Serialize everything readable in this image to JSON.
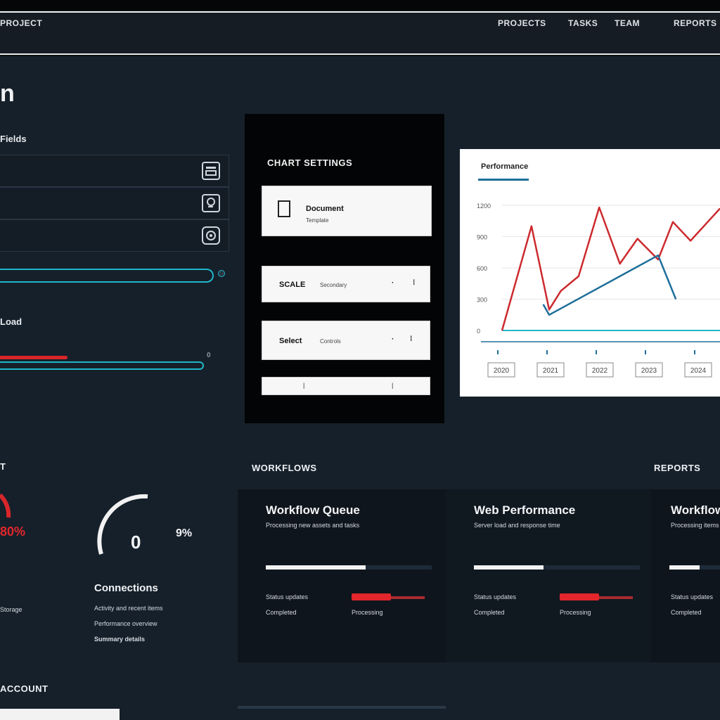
{
  "header": {
    "brand": "PROJECT",
    "nav": [
      "PROJECTS",
      "TASKS",
      "TEAM",
      "REPORTS"
    ]
  },
  "page": {
    "title": "n"
  },
  "form": {
    "section_label": "Fields",
    "inputs": [
      {
        "value": "",
        "placeholder": "",
        "icon": "save-icon"
      },
      {
        "value": "",
        "placeholder": "",
        "icon": "search-icon"
      },
      {
        "value": "",
        "placeholder": "",
        "icon": "settings-icon"
      }
    ],
    "slider_label": "Load",
    "slider_value_label": "0"
  },
  "center": {
    "title": "CHART SETTINGS",
    "cards": [
      {
        "title": "Document",
        "sub": "Template"
      },
      {
        "title": "SCALE",
        "sub": "Secondary"
      },
      {
        "title": "Select",
        "sub": "Controls"
      }
    ]
  },
  "chart_data": {
    "type": "line",
    "title": "Performance",
    "y_ticks": [
      "1200",
      "900",
      "600",
      "300",
      "0"
    ],
    "x_tick_labels": [
      "2020",
      "2021",
      "2022",
      "2023",
      "2024"
    ],
    "ylim": [
      0,
      1200
    ],
    "series": [
      {
        "color": "#cc2a2e",
        "x": [
          0,
          1,
          1.6,
          2,
          2.6,
          3.3,
          4,
          4.6,
          5.3,
          5.8,
          6.4,
          7.4
        ],
        "values": [
          0,
          1000,
          200,
          380,
          520,
          1180,
          640,
          880,
          680,
          1040,
          860,
          1170
        ]
      },
      {
        "color": "#1e6f9a",
        "x": [
          1.4,
          1.6,
          5.3,
          5.9
        ],
        "values": [
          250,
          150,
          720,
          300
        ]
      }
    ],
    "baseline_color": "#1fb7c9",
    "grid": true
  },
  "sections": {
    "left_head": "T",
    "middle_head": "WORKFLOWS",
    "right_head": "REPORTS",
    "bottom_head": "ACCOUNT"
  },
  "gauges": {
    "left_pct": "80%",
    "center_value": "0",
    "center_pct": "9%",
    "caption": "Connections",
    "lines": [
      "Activity and recent items",
      "Performance overview",
      "Summary details"
    ],
    "left_lines": [
      "Storage"
    ]
  },
  "status_cards": [
    {
      "title": "Workflow Queue",
      "sub": "Processing new assets and tasks",
      "progress": 0.6,
      "k1": "Status updates",
      "k2": "Completed",
      "v2": "Processing"
    },
    {
      "title": "Web Performance",
      "sub": "Server load and response time",
      "progress": 0.42,
      "k1": "Status updates",
      "k2": "Completed",
      "v2": "Processing"
    },
    {
      "title": "Workflow",
      "sub": "Processing items",
      "progress": 0.6,
      "k1": "Status updates",
      "k2": "Completed",
      "v2": ""
    }
  ],
  "colors": {
    "accent": "#1fb7c9",
    "alert": "#d9262a",
    "panel": "#16202a"
  }
}
